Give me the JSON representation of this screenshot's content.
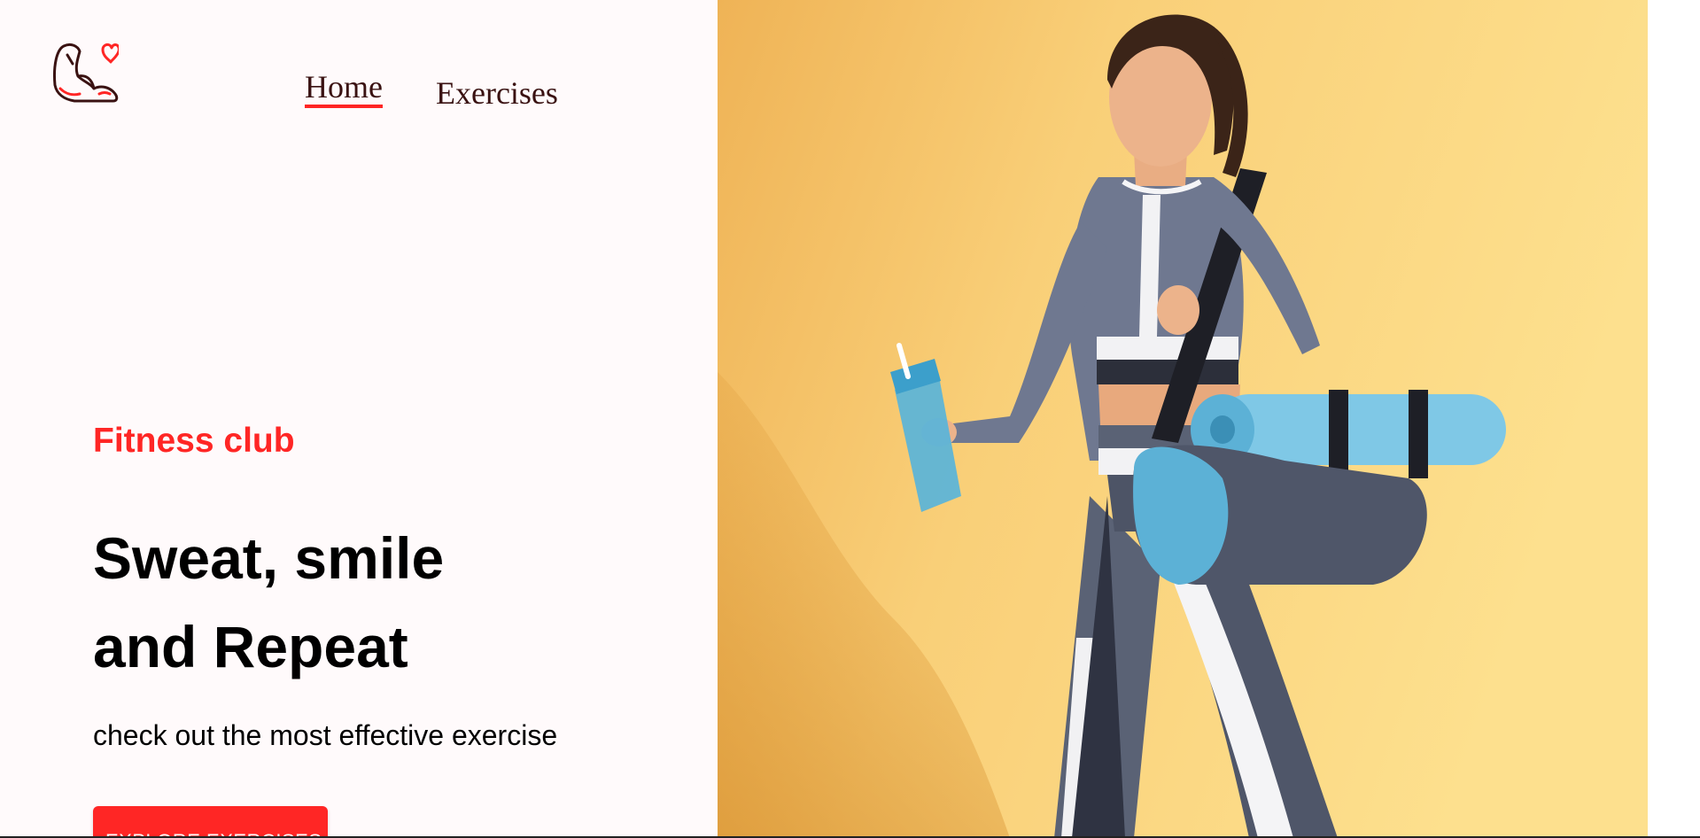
{
  "header": {
    "logo_icon": "flexed-arm-heart-icon",
    "nav": [
      {
        "label": "Home",
        "active": true
      },
      {
        "label": "Exercises",
        "active": false
      }
    ]
  },
  "hero": {
    "eyebrow": "Fitness club",
    "title_line1": "Sweat, smile",
    "title_line2": "and Repeat",
    "subtitle": "check out the most effective exercise",
    "button_label": "EXPLORE EXERCISES"
  },
  "colors": {
    "accent": "#ff2625",
    "background": "#fffafb",
    "text": "#000000",
    "nav_text": "#3a1212",
    "image_background": "#fbd57f"
  }
}
